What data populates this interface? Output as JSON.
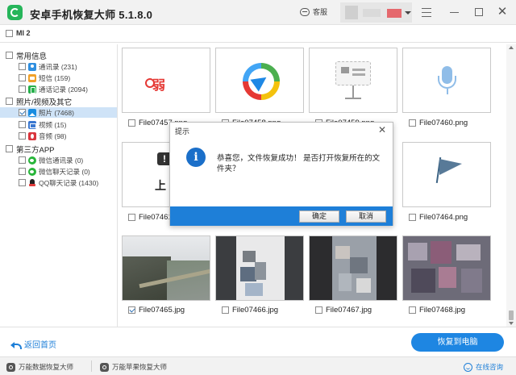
{
  "app": {
    "title": "安卓手机恢复大师  5.1.8.0",
    "support_label": "客服"
  },
  "device": {
    "name": "MI 2"
  },
  "sidebar": {
    "groups": [
      {
        "label": "常用信息",
        "items": [
          {
            "label": "通讯录 (231)",
            "icon": "contacts-icon"
          },
          {
            "label": "短信 (159)",
            "icon": "sms-icon"
          },
          {
            "label": "通话记录 (2094)",
            "icon": "call-log-icon"
          }
        ]
      },
      {
        "label": "照片/视频及其它",
        "items": [
          {
            "label": "照片 (7468)",
            "icon": "photo-icon"
          },
          {
            "label": "视频 (15)",
            "icon": "video-icon"
          },
          {
            "label": "音频 (98)",
            "icon": "audio-icon"
          }
        ]
      },
      {
        "label": "第三方APP",
        "items": [
          {
            "label": "微信通讯录 (0)",
            "icon": "wechat-icon"
          },
          {
            "label": "微信聊天记录 (0)",
            "icon": "wechat-icon"
          },
          {
            "label": "QQ聊天记录 (1430)",
            "icon": "qq-icon"
          }
        ]
      }
    ]
  },
  "grid": {
    "files": [
      {
        "name": "File07457.png",
        "checked": false
      },
      {
        "name": "File07458.png",
        "checked": false
      },
      {
        "name": "File07459.png",
        "checked": false
      },
      {
        "name": "File07460.png",
        "checked": false
      },
      {
        "name": "File07461.png",
        "checked": false
      },
      {
        "name": "File07464.png",
        "checked": false
      },
      {
        "name": "File07465.jpg",
        "checked": true
      },
      {
        "name": "File07466.jpg",
        "checked": false
      },
      {
        "name": "File07467.jpg",
        "checked": false
      },
      {
        "name": "File07468.jpg",
        "checked": false
      }
    ]
  },
  "dialog": {
    "title": "提示",
    "message": "恭喜您，文件恢复成功！ 是否打开恢复所在的文件夹？",
    "confirm_label": "确定",
    "cancel_label": "取消"
  },
  "actions": {
    "back_label": "返回首页",
    "recover_label": "恢复到电脑"
  },
  "footer": {
    "link1": "万能数据恢复大师",
    "link2": "万能苹果恢复大师",
    "online": "在线咨询"
  },
  "colors": {
    "accent": "#1e86e2",
    "selection": "#cfe3f7",
    "brand_green": "#26b55a"
  }
}
